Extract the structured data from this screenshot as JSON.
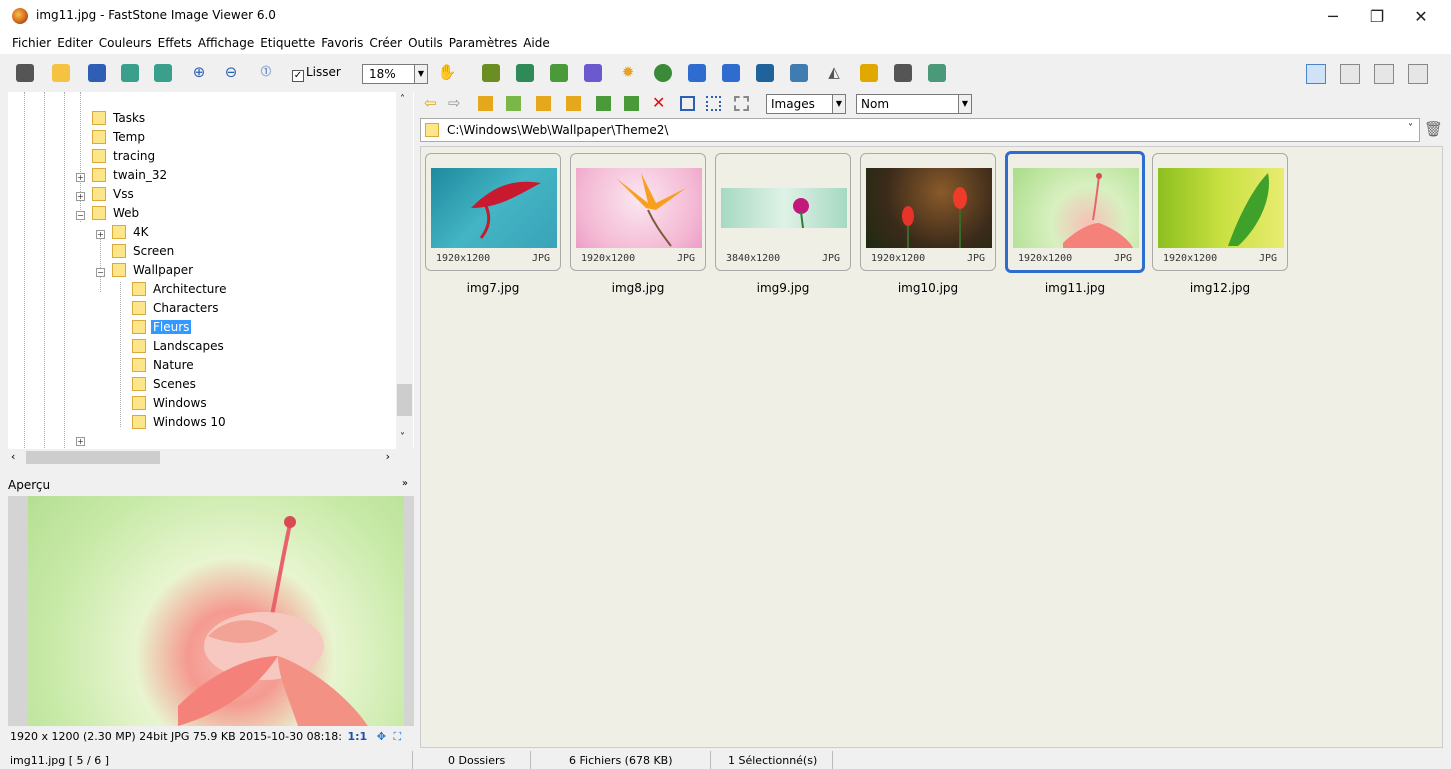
{
  "window": {
    "title": "img11.jpg  -  FastStone Image Viewer 6.0",
    "minimize": "─",
    "maximize": "❐",
    "close": "✕"
  },
  "menu": [
    "Fichier",
    "Editer",
    "Couleurs",
    "Effets",
    "Affichage",
    "Etiquette",
    "Favoris",
    "Créer",
    "Outils",
    "Paramètres",
    "Aide"
  ],
  "toolbar": {
    "smooth_label": "Lisser",
    "smooth_checked": true,
    "zoom": "18%"
  },
  "tree": {
    "nodes": [
      {
        "label": "Tasks"
      },
      {
        "label": "Temp"
      },
      {
        "label": "tracing"
      },
      {
        "label": "twain_32"
      },
      {
        "label": "Vss"
      },
      {
        "label": "Web"
      },
      {
        "label": "4K"
      },
      {
        "label": "Screen"
      },
      {
        "label": "Wallpaper"
      },
      {
        "label": "Architecture"
      },
      {
        "label": "Characters"
      },
      {
        "label": "Fleurs"
      },
      {
        "label": "Landscapes"
      },
      {
        "label": "Nature"
      },
      {
        "label": "Scenes"
      },
      {
        "label": "Windows"
      },
      {
        "label": "Windows 10"
      }
    ],
    "selected": "Fleurs"
  },
  "preview": {
    "title": "Aperçu",
    "info": "1920 x 1200 (2.30 MP)  24bit  JPG   75.9 KB   2015-10-30 08:18:",
    "ratio": "1:1"
  },
  "browser": {
    "filter": "Images",
    "sort": "Nom",
    "path": "C:\\Windows\\Web\\Wallpaper\\Theme2\\",
    "thumbs": [
      {
        "name": "img7.jpg",
        "dims": "1920x1200",
        "fmt": "JPG"
      },
      {
        "name": "img8.jpg",
        "dims": "1920x1200",
        "fmt": "JPG"
      },
      {
        "name": "img9.jpg",
        "dims": "3840x1200",
        "fmt": "JPG"
      },
      {
        "name": "img10.jpg",
        "dims": "1920x1200",
        "fmt": "JPG"
      },
      {
        "name": "img11.jpg",
        "dims": "1920x1200",
        "fmt": "JPG",
        "selected": true
      },
      {
        "name": "img12.jpg",
        "dims": "1920x1200",
        "fmt": "JPG"
      }
    ]
  },
  "status": {
    "file": "img11.jpg [ 5 / 6 ]",
    "folders": "0 Dossiers",
    "files": "6 Fichiers (678 KB)",
    "selected": "1 Sélectionné(s)"
  },
  "colors": {
    "selection": "#3399ff",
    "thumb_selected_border": "#2f6cd0",
    "browser_bg": "#f0efe6"
  }
}
